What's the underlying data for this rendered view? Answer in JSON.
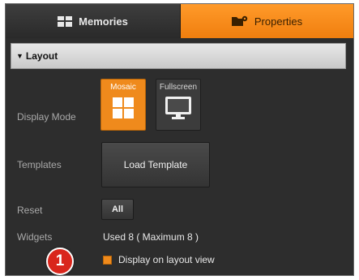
{
  "tabs": {
    "memories_label": "Memories",
    "properties_label": "Properties",
    "active": "Properties"
  },
  "layout": {
    "header_label": "Layout",
    "display_mode": {
      "label": "Display Mode",
      "options": [
        "Mosaic",
        "Fullscreen"
      ],
      "selected": "Mosaic"
    },
    "templates": {
      "label": "Templates",
      "button_label": "Load Template"
    },
    "reset": {
      "label": "Reset",
      "button_label": "All"
    },
    "widgets": {
      "label": "Widgets",
      "value": "Used 8 ( Maximum 8 )"
    },
    "display_on_layout_view": {
      "label": "Display on layout view",
      "checked": true
    }
  },
  "callout": {
    "number": "1"
  },
  "colors": {
    "accent": "#ef8a1c",
    "panel_bg": "#2d2d2d",
    "header_bg": "#d4d4d4",
    "callout": "#d9261c"
  }
}
